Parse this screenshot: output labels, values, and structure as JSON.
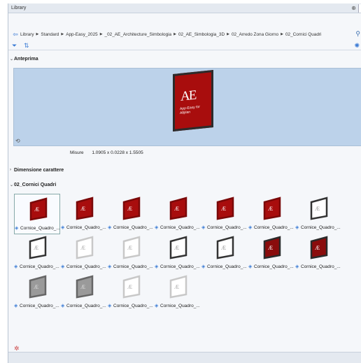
{
  "window": {
    "title": "Library"
  },
  "breadcrumb": {
    "items": [
      "Library",
      "Standard",
      "App-Easy_2025",
      "_02_AE_Architecture_Simbologia",
      "02_AE_Simbologia_3D",
      "02_Arredo Zona Giorno",
      "02_Cornici Quadri"
    ]
  },
  "sections": {
    "preview": "Anteprima",
    "size": "Dimensione carattere",
    "folder": "02_Cornici Quadri"
  },
  "preview_art": {
    "logo": "AE",
    "brand": "App-Easy for Allplan"
  },
  "measure": {
    "label": "Misure",
    "value": "1.0905 x 0.0228 x 1.5505"
  },
  "items": [
    {
      "label": "Cornice_Quadro_...",
      "style": "red"
    },
    {
      "label": "Cornice_Quadro_...",
      "style": "red"
    },
    {
      "label": "Cornice_Quadro_...",
      "style": "red"
    },
    {
      "label": "Cornice_Quadro_...",
      "style": "red"
    },
    {
      "label": "Cornice_Quadro_...",
      "style": "red"
    },
    {
      "label": "Cornice_Quadro_...",
      "style": "red"
    },
    {
      "label": "Cornice_Quadro_...",
      "style": "white-dark"
    },
    {
      "label": "Cornice_Quadro_...",
      "style": "white-dark"
    },
    {
      "label": "Cornice_Quadro_...",
      "style": "white-light"
    },
    {
      "label": "Cornice_Quadro_...",
      "style": "white-light"
    },
    {
      "label": "Cornice_Quadro_...",
      "style": "white-dark"
    },
    {
      "label": "Cornice_Quadro_...",
      "style": "white-dark"
    },
    {
      "label": "Cornice_Quadro_...",
      "style": "red-dark"
    },
    {
      "label": "Cornice_Quadro_...",
      "style": "red-dark"
    },
    {
      "label": "Cornice_Quadro_...",
      "style": "grey"
    },
    {
      "label": "Cornice_Quadro_...",
      "style": "grey"
    },
    {
      "label": "Cornice_Quadro_...",
      "style": "white-light"
    },
    {
      "label": "Cornice_Quadro_...",
      "style": "white-light"
    }
  ],
  "colors": {
    "accent": "#3a7bd5",
    "preview_bg": "#bcd2ea",
    "art_red": "#a80d0d"
  }
}
